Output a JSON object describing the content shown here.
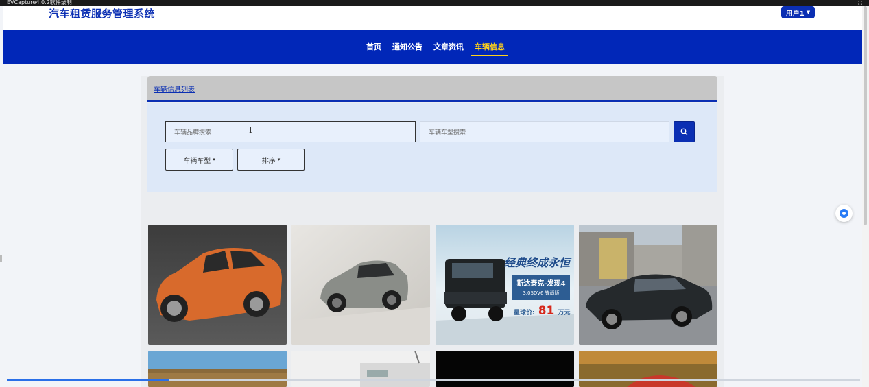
{
  "capture": {
    "title": "EVCapture4.0.2软件录制"
  },
  "header": {
    "site_title": "汽车租赁服务管理系统",
    "user_label": "用户1"
  },
  "nav": {
    "items": [
      {
        "label": "首页"
      },
      {
        "label": "通知公告"
      },
      {
        "label": "文章资讯"
      },
      {
        "label": "车辆信息"
      }
    ],
    "active": "车辆信息"
  },
  "list": {
    "title": "车辆信息列表"
  },
  "search": {
    "brand_placeholder": "车辆品牌搜索",
    "model_placeholder": "车辆车型搜索"
  },
  "filters": {
    "type_label": "车辆车型",
    "sort_label": "排序"
  },
  "cards": [
    {
      "image": "orange-suv"
    },
    {
      "image": "silver-coupe-suv"
    },
    {
      "image": "range-rover-ad"
    },
    {
      "image": "black-sedan"
    },
    {
      "image": "field-landscape"
    },
    {
      "image": "building"
    },
    {
      "image": "dark"
    },
    {
      "image": "red-car-autumn"
    }
  ],
  "ad": {
    "headline": "经典终成永恒",
    "model": "斯达泰克-发现4",
    "spec": "3.0SDV6 锋尚版",
    "price_label": "星球价:",
    "price_value": "81",
    "price_unit": "万元"
  },
  "colors": {
    "brand": "#0b2fb3",
    "nav_bg": "#0127b8",
    "nav_active": "#ffd11a"
  },
  "progress": {
    "value": 0.19
  }
}
